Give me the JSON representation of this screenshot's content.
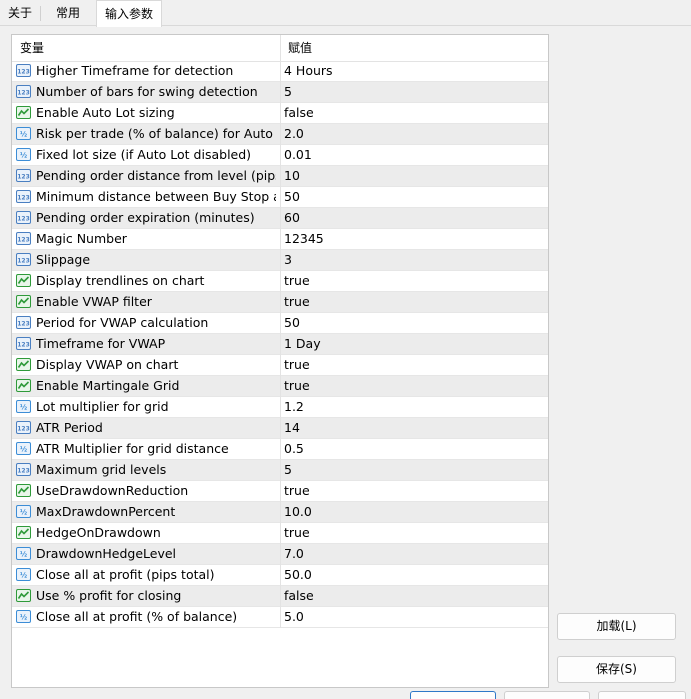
{
  "tabs": [
    {
      "label": "关于"
    },
    {
      "label": "常用"
    },
    {
      "label": "输入参数"
    }
  ],
  "grid": {
    "header": {
      "variable": "变量",
      "value": "赋值"
    },
    "rows": [
      {
        "name": "Higher Timeframe for detection",
        "value": "4 Hours",
        "icon": "integer-icon"
      },
      {
        "name": "Number of bars for swing detection",
        "value": "5",
        "icon": "integer-icon"
      },
      {
        "name": "Enable Auto Lot sizing",
        "value": "false",
        "icon": "boolean-icon"
      },
      {
        "name": "Risk per trade (% of balance) for Auto ...",
        "value": "2.0",
        "icon": "double-icon"
      },
      {
        "name": "Fixed lot size (if Auto Lot disabled)",
        "value": "0.01",
        "icon": "double-icon"
      },
      {
        "name": "Pending order distance from level (pips)",
        "value": "10",
        "icon": "integer-icon"
      },
      {
        "name": "Minimum distance between Buy Stop a...",
        "value": "50",
        "icon": "integer-icon"
      },
      {
        "name": "Pending order expiration (minutes)",
        "value": "60",
        "icon": "integer-icon"
      },
      {
        "name": "Magic Number",
        "value": "12345",
        "icon": "integer-icon"
      },
      {
        "name": "Slippage",
        "value": "3",
        "icon": "integer-icon"
      },
      {
        "name": "Display trendlines on chart",
        "value": "true",
        "icon": "boolean-icon"
      },
      {
        "name": "Enable VWAP filter",
        "value": "true",
        "icon": "boolean-icon"
      },
      {
        "name": "Period for VWAP calculation",
        "value": "50",
        "icon": "integer-icon"
      },
      {
        "name": "Timeframe for VWAP",
        "value": "1 Day",
        "icon": "integer-icon"
      },
      {
        "name": "Display VWAP on chart",
        "value": "true",
        "icon": "boolean-icon"
      },
      {
        "name": "Enable Martingale Grid",
        "value": "true",
        "icon": "boolean-icon"
      },
      {
        "name": "Lot multiplier for grid",
        "value": "1.2",
        "icon": "double-icon"
      },
      {
        "name": "ATR Period",
        "value": "14",
        "icon": "integer-icon"
      },
      {
        "name": "ATR Multiplier for grid distance",
        "value": "0.5",
        "icon": "double-icon"
      },
      {
        "name": "Maximum grid levels",
        "value": "5",
        "icon": "integer-icon"
      },
      {
        "name": "UseDrawdownReduction",
        "value": "true",
        "icon": "boolean-icon"
      },
      {
        "name": "MaxDrawdownPercent",
        "value": "10.0",
        "icon": "double-icon"
      },
      {
        "name": "HedgeOnDrawdown",
        "value": "true",
        "icon": "boolean-icon"
      },
      {
        "name": "DrawdownHedgeLevel",
        "value": "7.0",
        "icon": "double-icon"
      },
      {
        "name": "Close all at profit (pips total)",
        "value": "50.0",
        "icon": "double-icon"
      },
      {
        "name": "Use % profit for closing",
        "value": "false",
        "icon": "boolean-icon"
      },
      {
        "name": "Close all at profit (% of balance)",
        "value": "5.0",
        "icon": "double-icon"
      }
    ]
  },
  "buttons": {
    "load": "加载(L)",
    "save": "保存(S)"
  },
  "colors": {
    "integer_icon": "#4a7fc1",
    "double_icon": "#3c8dd6",
    "boolean_icon": "#2f9a3a"
  }
}
